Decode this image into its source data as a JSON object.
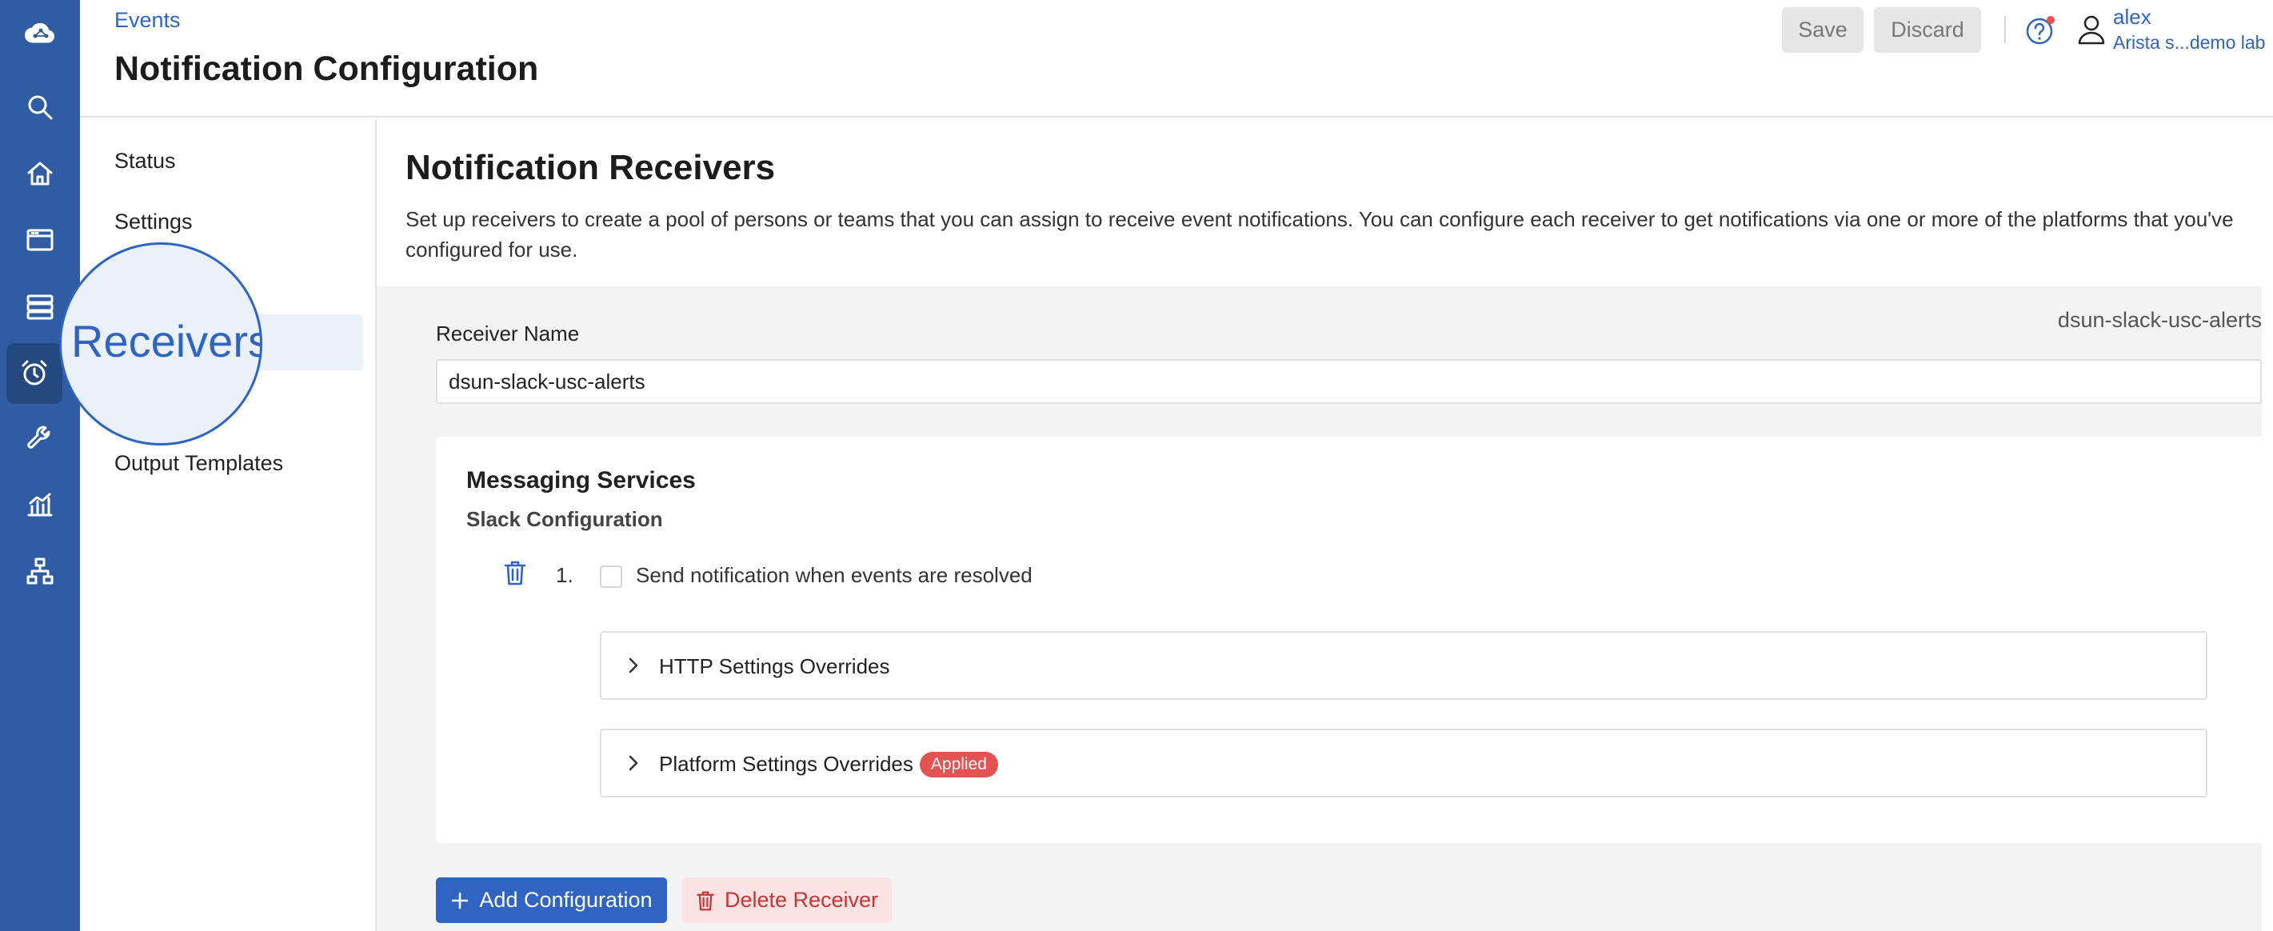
{
  "header": {
    "breadcrumb": "Events",
    "title": "Notification Configuration",
    "save_label": "Save",
    "discard_label": "Discard",
    "user_name": "alex",
    "user_org": "Arista s...demo lab"
  },
  "rail": {
    "icons": [
      "cloud-logo-icon",
      "search-icon",
      "home-icon",
      "devices-icon",
      "inventory-icon",
      "alarm-icon",
      "wrench-icon",
      "dashboard-chart-icon",
      "topology-icon"
    ],
    "active": "alarm-icon"
  },
  "subnav": {
    "items": [
      "Status",
      "Settings",
      "Receivers",
      "Output Templates"
    ],
    "active": "Receivers",
    "magnified_label": "Receivers"
  },
  "main": {
    "section_title": "Notification Receivers",
    "section_desc": "Set up receivers to create a pool of persons or teams that you can assign to receive event notifications. You can configure each receiver to get notifications via one or more of the platforms that you've configured for use.",
    "receiver_id": "dsun-slack-usc-alerts",
    "receiver_name_label": "Receiver Name",
    "receiver_name_value": "dsun-slack-usc-alerts",
    "services_title": "Messaging Services",
    "slack_title": "Slack Configuration",
    "item_number": "1.",
    "resolved_label": "Send notification when events are resolved",
    "http_overrides": "HTTP Settings Overrides",
    "platform_overrides": "Platform Settings Overrides",
    "applied_badge": "Applied",
    "add_config_label": "Add Configuration",
    "delete_receiver_label": "Delete Receiver"
  },
  "colors": {
    "rail": "#2f5ca3",
    "accent": "#2f64c3",
    "badge": "#e45252",
    "danger_bg": "#fbe3e3"
  }
}
